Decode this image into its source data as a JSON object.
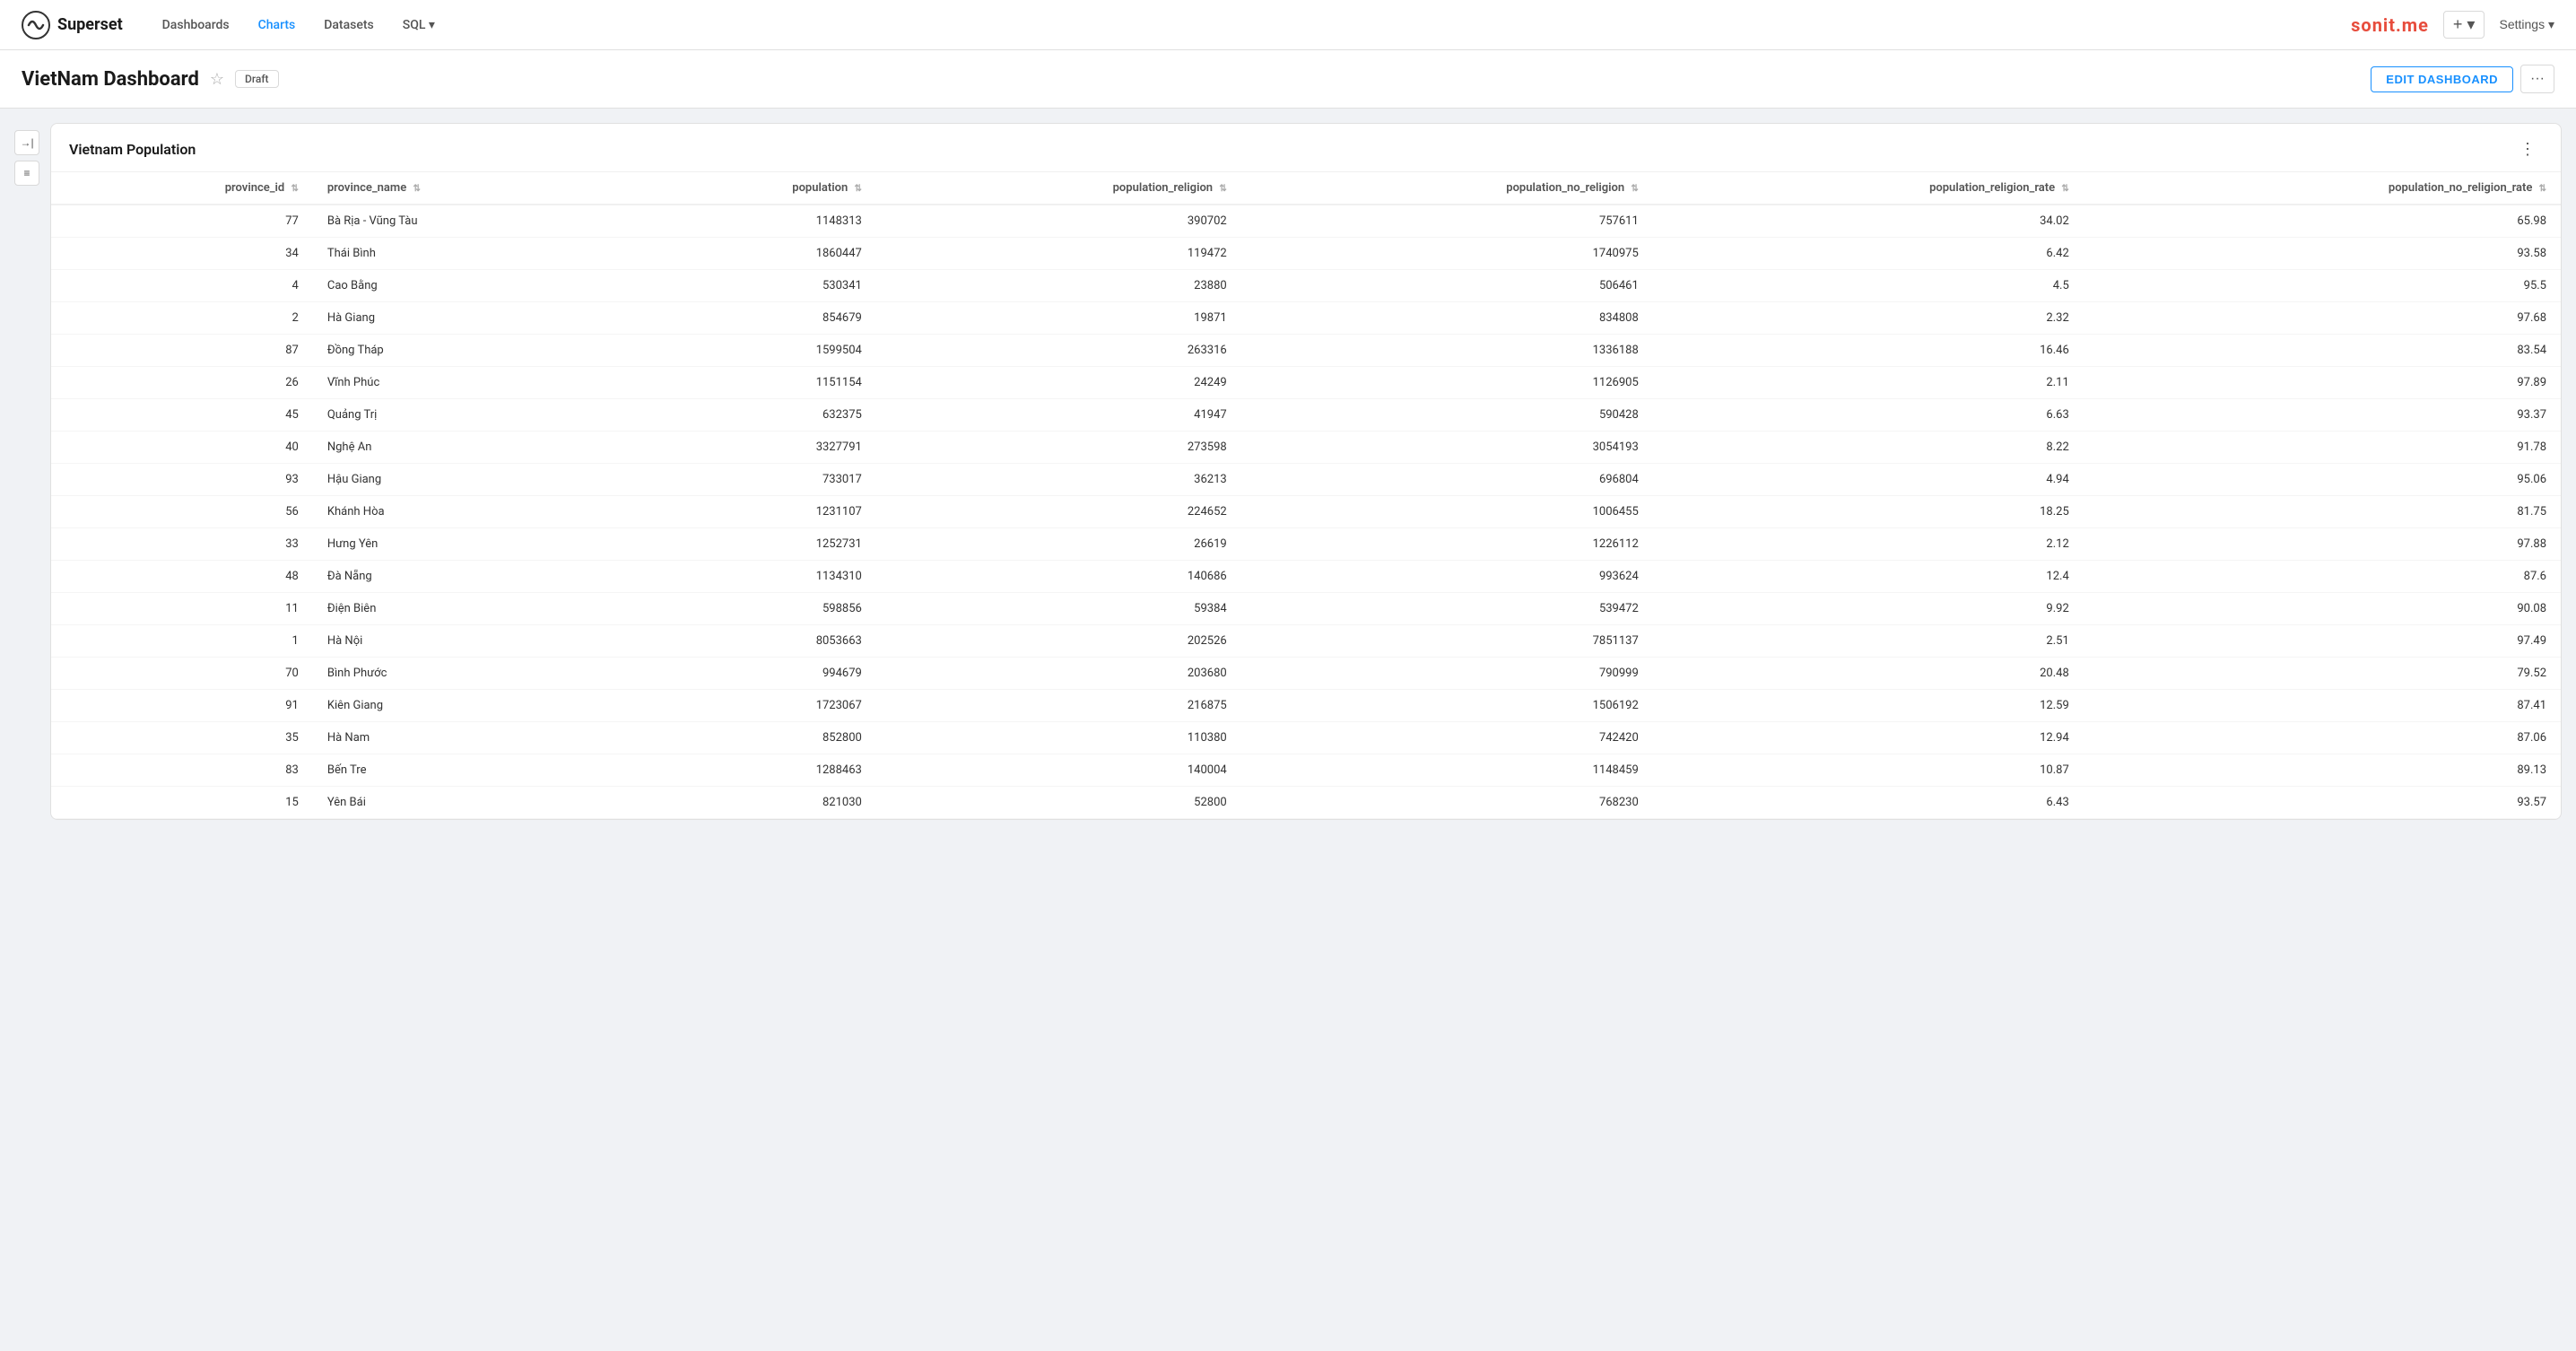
{
  "navbar": {
    "brand": "Superset",
    "nav_links": [
      {
        "label": "Dashboards",
        "active": false
      },
      {
        "label": "Charts",
        "active": true
      },
      {
        "label": "Datasets",
        "active": false
      },
      {
        "label": "SQL ▾",
        "active": false
      }
    ],
    "brand_name": "sonit.me",
    "add_btn": "+ ▾",
    "settings_btn": "Settings ▾"
  },
  "dashboard": {
    "title": "VietNam Dashboard",
    "badge": "Draft",
    "edit_btn": "EDIT DASHBOARD",
    "more_btn": "···"
  },
  "chart": {
    "title": "Vietnam Population",
    "more_btn": "⋮",
    "columns": [
      {
        "key": "province_id",
        "label": "province_id"
      },
      {
        "key": "province_name",
        "label": "province_name"
      },
      {
        "key": "population",
        "label": "population"
      },
      {
        "key": "population_religion",
        "label": "population_religion"
      },
      {
        "key": "population_no_religion",
        "label": "population_no_religion"
      },
      {
        "key": "population_religion_rate",
        "label": "population_religion_rate"
      },
      {
        "key": "population_no_religion_rate",
        "label": "population_no_religion_rate"
      }
    ],
    "rows": [
      {
        "province_id": "77",
        "province_name": "Bà Rịa - Vũng Tàu",
        "population": "1148313",
        "population_religion": "390702",
        "population_no_religion": "757611",
        "population_religion_rate": "34.02",
        "population_no_religion_rate": "65.98"
      },
      {
        "province_id": "34",
        "province_name": "Thái Bình",
        "population": "1860447",
        "population_religion": "119472",
        "population_no_religion": "1740975",
        "population_religion_rate": "6.42",
        "population_no_religion_rate": "93.58"
      },
      {
        "province_id": "4",
        "province_name": "Cao Bằng",
        "population": "530341",
        "population_religion": "23880",
        "population_no_religion": "506461",
        "population_religion_rate": "4.5",
        "population_no_religion_rate": "95.5"
      },
      {
        "province_id": "2",
        "province_name": "Hà Giang",
        "population": "854679",
        "population_religion": "19871",
        "population_no_religion": "834808",
        "population_religion_rate": "2.32",
        "population_no_religion_rate": "97.68"
      },
      {
        "province_id": "87",
        "province_name": "Đồng Tháp",
        "population": "1599504",
        "population_religion": "263316",
        "population_no_religion": "1336188",
        "population_religion_rate": "16.46",
        "population_no_religion_rate": "83.54"
      },
      {
        "province_id": "26",
        "province_name": "Vĩnh Phúc",
        "population": "1151154",
        "population_religion": "24249",
        "population_no_religion": "1126905",
        "population_religion_rate": "2.11",
        "population_no_religion_rate": "97.89"
      },
      {
        "province_id": "45",
        "province_name": "Quảng Trị",
        "population": "632375",
        "population_religion": "41947",
        "population_no_religion": "590428",
        "population_religion_rate": "6.63",
        "population_no_religion_rate": "93.37"
      },
      {
        "province_id": "40",
        "province_name": "Nghệ An",
        "population": "3327791",
        "population_religion": "273598",
        "population_no_religion": "3054193",
        "population_religion_rate": "8.22",
        "population_no_religion_rate": "91.78"
      },
      {
        "province_id": "93",
        "province_name": "Hậu Giang",
        "population": "733017",
        "population_religion": "36213",
        "population_no_religion": "696804",
        "population_religion_rate": "4.94",
        "population_no_religion_rate": "95.06"
      },
      {
        "province_id": "56",
        "province_name": "Khánh Hòa",
        "population": "1231107",
        "population_religion": "224652",
        "population_no_religion": "1006455",
        "population_religion_rate": "18.25",
        "population_no_religion_rate": "81.75"
      },
      {
        "province_id": "33",
        "province_name": "Hưng Yên",
        "population": "1252731",
        "population_religion": "26619",
        "population_no_religion": "1226112",
        "population_religion_rate": "2.12",
        "population_no_religion_rate": "97.88"
      },
      {
        "province_id": "48",
        "province_name": "Đà Nẵng",
        "population": "1134310",
        "population_religion": "140686",
        "population_no_religion": "993624",
        "population_religion_rate": "12.4",
        "population_no_religion_rate": "87.6"
      },
      {
        "province_id": "11",
        "province_name": "Điện Biên",
        "population": "598856",
        "population_religion": "59384",
        "population_no_religion": "539472",
        "population_religion_rate": "9.92",
        "population_no_religion_rate": "90.08"
      },
      {
        "province_id": "1",
        "province_name": "Hà Nội",
        "population": "8053663",
        "population_religion": "202526",
        "population_no_religion": "7851137",
        "population_religion_rate": "2.51",
        "population_no_religion_rate": "97.49"
      },
      {
        "province_id": "70",
        "province_name": "Bình Phước",
        "population": "994679",
        "population_religion": "203680",
        "population_no_religion": "790999",
        "population_religion_rate": "20.48",
        "population_no_religion_rate": "79.52"
      },
      {
        "province_id": "91",
        "province_name": "Kiên Giang",
        "population": "1723067",
        "population_religion": "216875",
        "population_no_religion": "1506192",
        "population_religion_rate": "12.59",
        "population_no_religion_rate": "87.41"
      },
      {
        "province_id": "35",
        "province_name": "Hà Nam",
        "population": "852800",
        "population_religion": "110380",
        "population_no_religion": "742420",
        "population_religion_rate": "12.94",
        "population_no_religion_rate": "87.06"
      },
      {
        "province_id": "83",
        "province_name": "Bến Tre",
        "population": "1288463",
        "population_religion": "140004",
        "population_no_religion": "1148459",
        "population_religion_rate": "10.87",
        "population_no_religion_rate": "89.13"
      },
      {
        "province_id": "15",
        "province_name": "Yên Bái",
        "population": "821030",
        "population_religion": "52800",
        "population_no_religion": "768230",
        "population_religion_rate": "6.43",
        "population_no_religion_rate": "93.57"
      }
    ]
  },
  "sidebar": {
    "expand_icon": "→|",
    "filter_icon": "≡"
  }
}
